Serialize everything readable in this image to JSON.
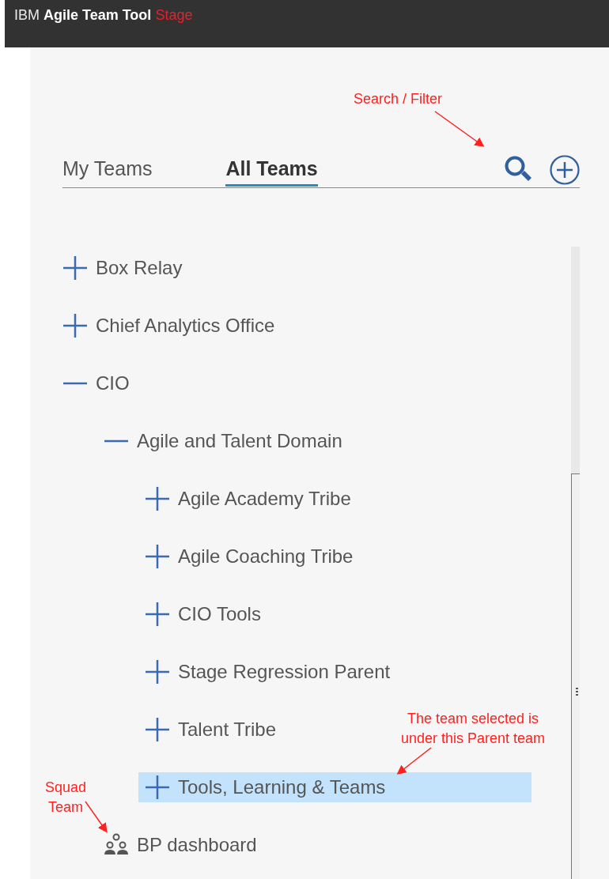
{
  "header": {
    "brand": "IBM",
    "product": "Agile Team Tool",
    "environment": "Stage"
  },
  "tabs": [
    {
      "label": "My Teams",
      "selected": false
    },
    {
      "label": "All Teams",
      "selected": true
    }
  ],
  "tree": [
    {
      "label": "Box Relay",
      "kind": "team",
      "expanded": false,
      "selected": false
    },
    {
      "label": "Chief Analytics Office",
      "kind": "team",
      "expanded": false,
      "selected": false
    },
    {
      "label": "CIO",
      "kind": "team",
      "expanded": true,
      "selected": false,
      "children": [
        {
          "label": "Agile and Talent Domain",
          "kind": "team",
          "expanded": true,
          "selected": false,
          "children": [
            {
              "label": "Agile Academy Tribe",
              "kind": "team",
              "expanded": false,
              "selected": false
            },
            {
              "label": "Agile Coaching Tribe",
              "kind": "team",
              "expanded": false,
              "selected": false
            },
            {
              "label": "CIO Tools",
              "kind": "team",
              "expanded": false,
              "selected": false
            },
            {
              "label": "Stage Regression Parent",
              "kind": "team",
              "expanded": false,
              "selected": false
            },
            {
              "label": "Talent Tribe",
              "kind": "team",
              "expanded": false,
              "selected": false
            },
            {
              "label": "Tools, Learning & Teams",
              "kind": "team",
              "expanded": false,
              "selected": true
            }
          ]
        },
        {
          "label": "BP dashboard",
          "kind": "squad",
          "selected": false
        }
      ]
    }
  ],
  "annotations": [
    {
      "text": "Search / Filter",
      "kind": "search"
    },
    {
      "text": "The team selected is under this Parent team",
      "kind": "selected"
    },
    {
      "text": "Squad Team",
      "kind": "squad"
    }
  ]
}
